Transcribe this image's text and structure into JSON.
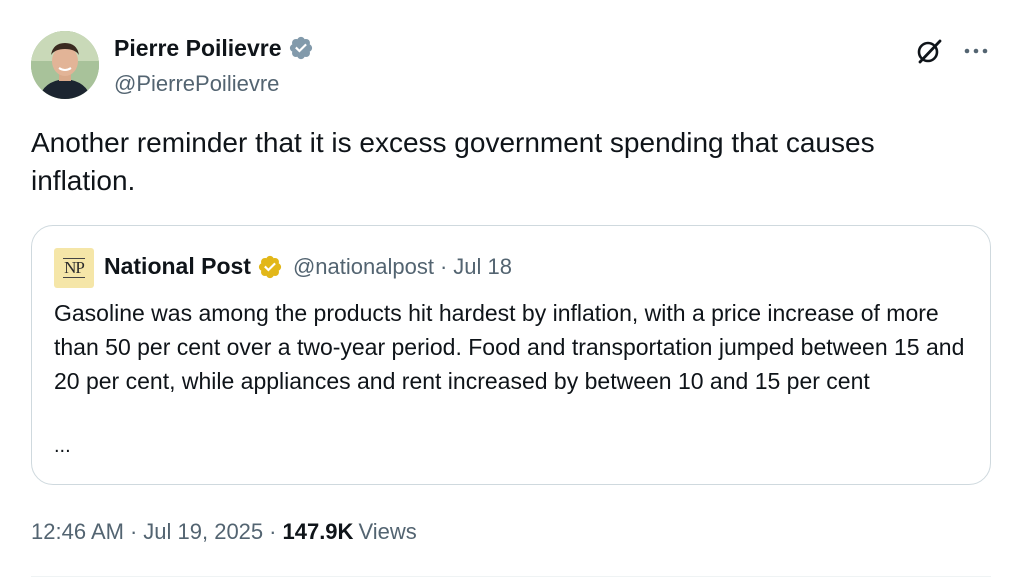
{
  "author": {
    "name": "Pierre Poilievre",
    "handle": "@PierrePoilievre",
    "verified_color": "#829aab"
  },
  "header_icons": {
    "grok": "grok-icon",
    "more": "more-icon"
  },
  "tweet": {
    "text": "Another reminder that it is excess government spending that causes inflation."
  },
  "quote": {
    "logo_text": "NP",
    "name": "National Post",
    "verified_color": "#e2b719",
    "handle": "@nationalpost",
    "separator": "·",
    "date": "Jul 18",
    "text": "Gasoline was among the products hit hardest by inflation, with a price increase of more than 50 per cent over a two-year period. Food and transportation jumped between 15 and 20 per cent, while appliances and rent increased by between 10 and 15 per cent",
    "ellipsis": "..."
  },
  "meta": {
    "time": "12:46 AM",
    "separator": "·",
    "date": "Jul 19, 2025",
    "views_count": "147.9K",
    "views_label": "Views"
  },
  "colors": {
    "text": "#0f1419",
    "secondary": "#536471",
    "border": "#cfd9de"
  }
}
